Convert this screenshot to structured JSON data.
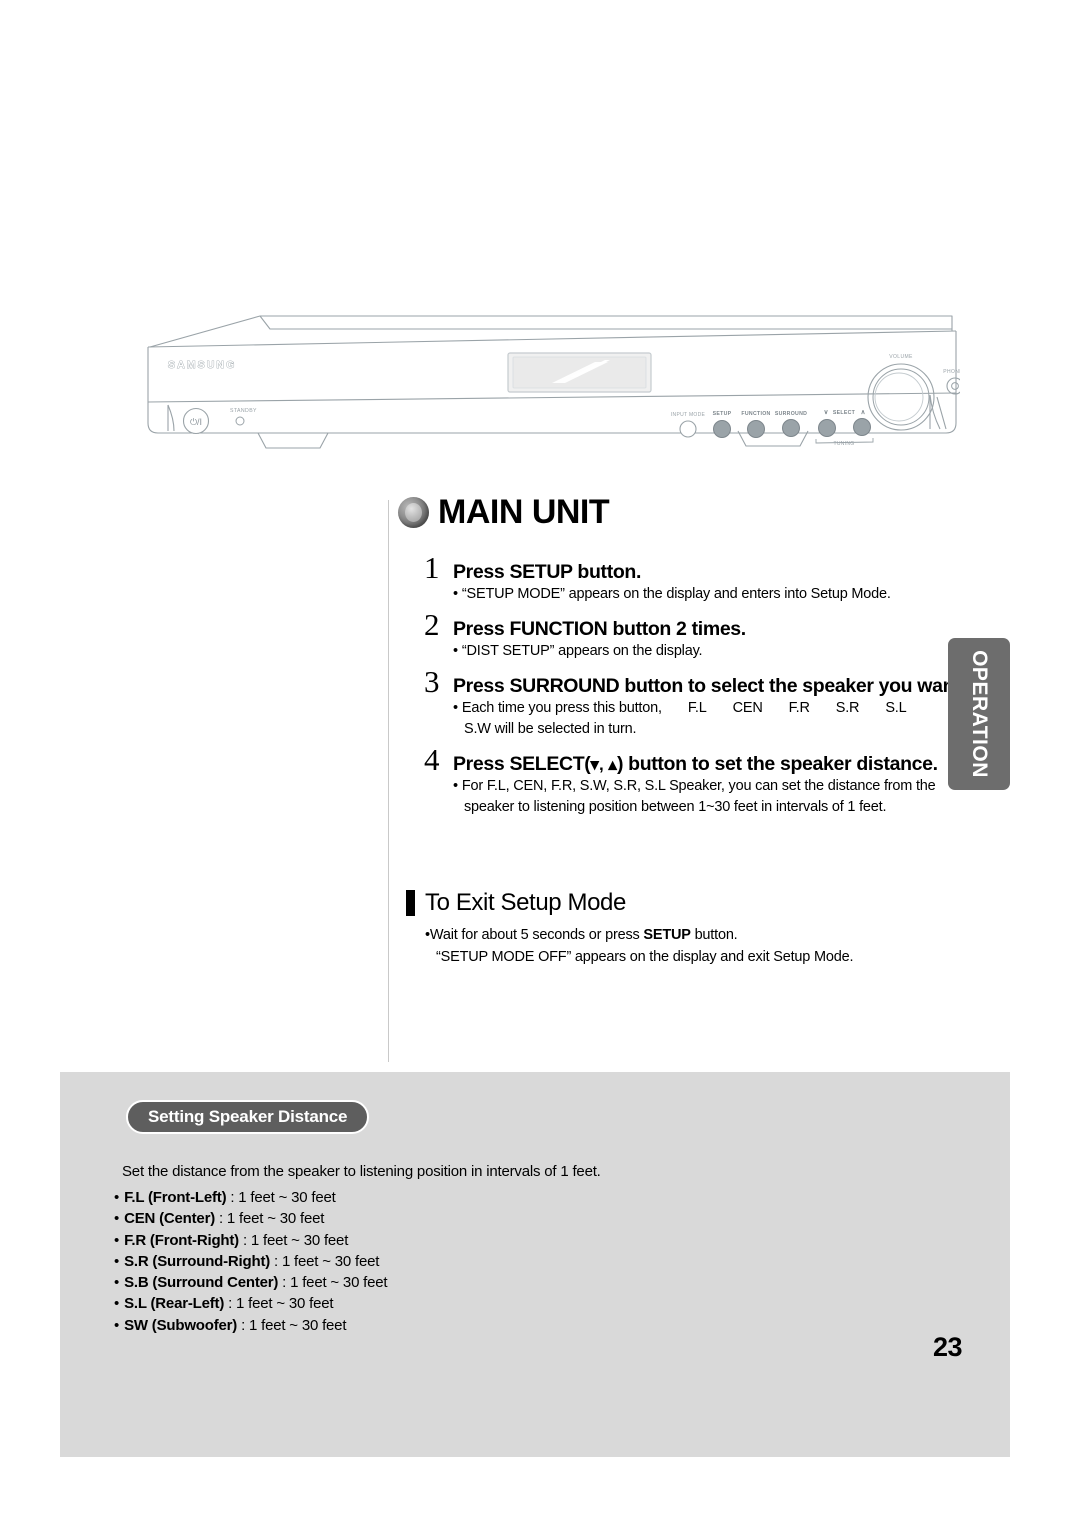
{
  "page": {
    "number": "23",
    "side_tab_label": "OPERATION"
  },
  "device": {
    "brand": "SAMSUNG",
    "power_label": "⏻/I",
    "standby_label": "STANDBY",
    "volume_label": "VOLUME",
    "phones_label": "PHONES",
    "tuning_label": "TUNING",
    "buttons": [
      {
        "label": "INPUT MODE"
      },
      {
        "label": "SETUP"
      },
      {
        "label": "FUNCTION"
      },
      {
        "label": "SURROUND"
      },
      {
        "label": "SELECT"
      }
    ],
    "select_down_glyph": "∨",
    "select_up_glyph": "∧"
  },
  "heading": {
    "title": "MAIN UNIT"
  },
  "steps": [
    {
      "num": "1",
      "title": "Press SETUP button.",
      "body_line1": "“SETUP MODE” appears on the display and enters into Setup Mode.",
      "body_line2": ""
    },
    {
      "num": "2",
      "title": "Press FUNCTION button 2 times.",
      "body_line1": "“DIST SETUP” appears on the display.",
      "body_line2": ""
    },
    {
      "num": "3",
      "title": "Press SURROUND button to select the speaker you want.",
      "body_line1_prefix": "Each time you press this button,",
      "body_sequence": [
        "F.L",
        "CEN",
        "F.R",
        "S.R",
        "S.L"
      ],
      "body_line2": "S.W  will be selected in turn."
    },
    {
      "num": "4",
      "title_before": "Press SELECT(",
      "title_chevrons": "▾, ▴",
      "title_after": ") button to set the speaker distance.",
      "body_line1": "For F.L, CEN, F.R, S.W, S.R, S.L Speaker, you can set the distance from the",
      "body_line2": "speaker to listening position between 1~30 feet in intervals of 1 feet."
    }
  ],
  "exit_section": {
    "title": "To Exit Setup Mode",
    "body_line1_a": "Wait for about 5 seconds or press ",
    "body_line1_bold": "SETUP",
    "body_line1_b": " button.",
    "body_line2": "“SETUP MODE OFF” appears on the display and exit Setup Mode."
  },
  "panel": {
    "pill_label": "Setting Speaker Distance",
    "intro": "Set the distance from the speaker to listening position in intervals of 1 feet.",
    "items": [
      {
        "name": "F.L (Front-Left)",
        "value": ": 1 feet ~ 30 feet"
      },
      {
        "name": "CEN (Center)",
        "value": ": 1 feet ~ 30 feet"
      },
      {
        "name": "F.R (Front-Right)",
        "value": ": 1 feet ~ 30 feet"
      },
      {
        "name": "S.R (Surround-Right)",
        "value": ": 1 feet  ~ 30 feet"
      },
      {
        "name": "S.B (Surround Center)",
        "value": ": 1 feet  ~ 30 feet"
      },
      {
        "name": "S.L (Rear-Left)",
        "value": ": 1 feet ~ 30 feet"
      },
      {
        "name": "SW (Subwoofer)",
        "value": ": 1 feet ~ 30 feet"
      }
    ]
  },
  "colors": {
    "panel_bg": "#d9d9d9",
    "pill_bg": "#5e5e5e",
    "side_tab_bg": "#6d6d6d",
    "device_outline": "#9aa3a8"
  }
}
